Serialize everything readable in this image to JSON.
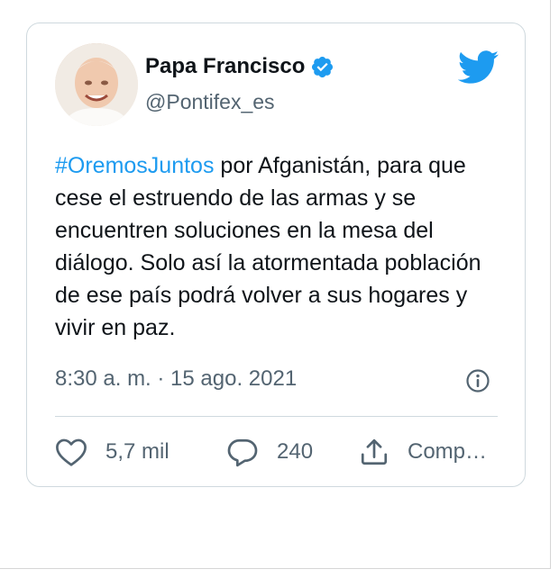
{
  "author": {
    "name": "Papa Francisco",
    "handle": "@Pontifex_es"
  },
  "tweet": {
    "hashtag": "#OremosJuntos",
    "body": " por Afganistán, para que cese el estruendo de las armas y se encuentren soluciones en la mesa del diálogo. Solo así la atormentada población de ese país podrá volver a sus hogares y vivir en paz.",
    "timestamp": "8:30 a. m. · 15 ago. 2021"
  },
  "actions": {
    "likes": "5,7 mil",
    "replies": "240",
    "share_label": "Comp…"
  },
  "colors": {
    "accent": "#1d9bf0",
    "text": "#0f1419",
    "muted": "#536471",
    "border": "#cfd9de"
  },
  "icons": [
    "avatar-photo",
    "verified-badge-icon",
    "twitter-bird-icon",
    "info-icon",
    "heart-icon",
    "reply-bubble-icon",
    "share-icon"
  ]
}
